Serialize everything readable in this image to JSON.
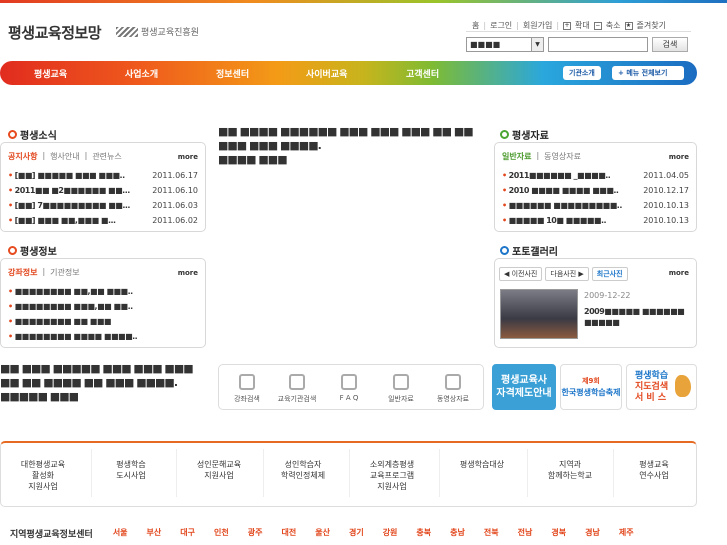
{
  "site": {
    "title": "평생교육정보망",
    "org": "평생교육진흥원"
  },
  "util": {
    "home": "홈",
    "login": "로그인",
    "join": "회원가입",
    "zoom_in": "확대",
    "zoom_out": "축소",
    "favorites": "즐겨찾기",
    "zoom_in_symbol": "+",
    "zoom_out_symbol": "−",
    "favorites_symbol": "★"
  },
  "search": {
    "select_value": "■■■■",
    "button": "검색"
  },
  "nav": {
    "items": [
      "평생교육",
      "사업소개",
      "정보센터",
      "사이버교육",
      "고객센터"
    ],
    "intro_button": "기관소개",
    "all_menu_button": "메뉴 전체보기"
  },
  "news": {
    "title": "평생소식",
    "tabs": [
      "공지사항",
      "행사안내",
      "관련뉴스"
    ],
    "more": "more",
    "rows": [
      {
        "title": "[■■] ■■■■■ ■■■ ■■■..",
        "date": "2011.06.17"
      },
      {
        "title": "2011■■ ■2■■■■■■ ■■...",
        "date": "2011.06.10"
      },
      {
        "title": "[■■] 7■■■■■■■■■ ■■...",
        "date": "2011.06.03"
      },
      {
        "title": "[■■] ■■■ ■■,■■■ ■...",
        "date": "2011.06.02"
      }
    ]
  },
  "center_notice": {
    "line1": "■■ ■■■■ ■■■■■■ ■■■ ■■■ ■■■ ■■ ■■",
    "line2": "■■■ ■■■ ■■■■.",
    "line3": "■■■■ ■■■"
  },
  "resources": {
    "title": "평생자료",
    "tabs": [
      "일반자료",
      "동영상자료"
    ],
    "more": "more",
    "rows": [
      {
        "title": "2011■■■■■■ _■■■■..",
        "date": "2011.04.05"
      },
      {
        "title": "2010 ■■■■ ■■■■ ■■■..",
        "date": "2010.12.17"
      },
      {
        "title": "■■■■■■ ■■■■■■■■■..",
        "date": "2010.10.13"
      },
      {
        "title": "■■■■■ 10■ ■■■■■..",
        "date": "2010.10.13"
      }
    ]
  },
  "info": {
    "title": "평생정보",
    "tabs": [
      "강좌정보",
      "기관정보"
    ],
    "more": "more",
    "rows": [
      {
        "title": "■■■■■■■■ ■■,■■ ■■■.."
      },
      {
        "title": "■■■■■■■■ ■■■,■■ ■■.."
      },
      {
        "title": "■■■■■■■■ ■■ ■■■"
      },
      {
        "title": "■■■■■■■■ ■■■■ ■■■■.."
      }
    ]
  },
  "gallery": {
    "title": "포토갤러리",
    "prev": "이전사진",
    "next": "다음사진",
    "latest": "최근사진",
    "more": "more",
    "date": "2009-12-22",
    "caption": "2009■■■■■ ■■■■■■ ■■■■■"
  },
  "left_notice": {
    "line1": "■■ ■■■ ■■■■■ ■■■ ■■■ ■■■",
    "line2": "■■ ■■ ■■■■ ■■ ■■■ ■■■■.",
    "line3": "■■■■■ ■■■"
  },
  "quick": [
    "강좌검색",
    "교육기관검색",
    "F A Q",
    "일반자료",
    "동영상자료"
  ],
  "banners": {
    "b1_line1": "평생교육사",
    "b1_line2": "자격제도안내",
    "b2_line1": "제9회",
    "b2_line2": "한국평생학습축제",
    "b3_line1": "평생학습",
    "b3_line2": "지도검색",
    "b3_line3": "서 비 스"
  },
  "bottom_menu": [
    [
      "대한평생교육",
      "활성화",
      "지원사업"
    ],
    [
      "평생학습",
      "도시사업"
    ],
    [
      "성인문해교육",
      "지원사업"
    ],
    [
      "성인학습자",
      "학력인정체제"
    ],
    [
      "소외계층평생",
      "교육프로그램",
      "지원사업"
    ],
    [
      "평생학습대상"
    ],
    [
      "지역과",
      "함께하는학교"
    ],
    [
      "평생교육",
      "연수사업"
    ]
  ],
  "regions": {
    "label": "지역평생교육정보센터",
    "items": [
      "서울",
      "부산",
      "대구",
      "인천",
      "광주",
      "대전",
      "울산",
      "경기",
      "강원",
      "충북",
      "충남",
      "전북",
      "전남",
      "경북",
      "경남",
      "제주"
    ]
  },
  "colors": {
    "accent": "#e2471d",
    "green": "#4a9a2c",
    "blue": "#1d76c9",
    "banner_blue": "#3aa0d6"
  }
}
